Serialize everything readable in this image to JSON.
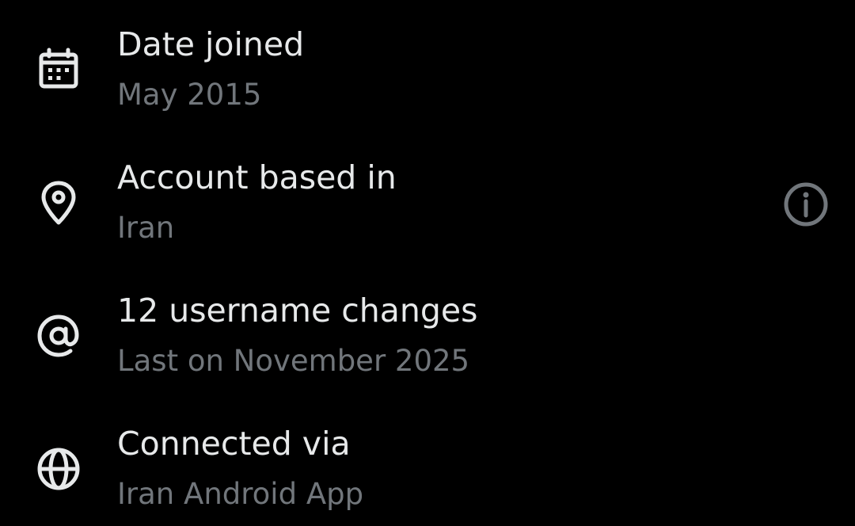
{
  "colors": {
    "background": "#000000",
    "primary_text": "#e7e9ea",
    "secondary_text": "#71767b"
  },
  "rows": [
    {
      "icon": "calendar-icon",
      "title": "Date joined",
      "subtitle": "May 2015"
    },
    {
      "icon": "location-pin-icon",
      "title": "Account based in",
      "subtitle": "Iran",
      "action_icon": "info-icon"
    },
    {
      "icon": "at-sign-icon",
      "title": "12 username changes",
      "subtitle": "Last on November 2025"
    },
    {
      "icon": "globe-icon",
      "title": "Connected via",
      "subtitle": "Iran Android App"
    }
  ]
}
